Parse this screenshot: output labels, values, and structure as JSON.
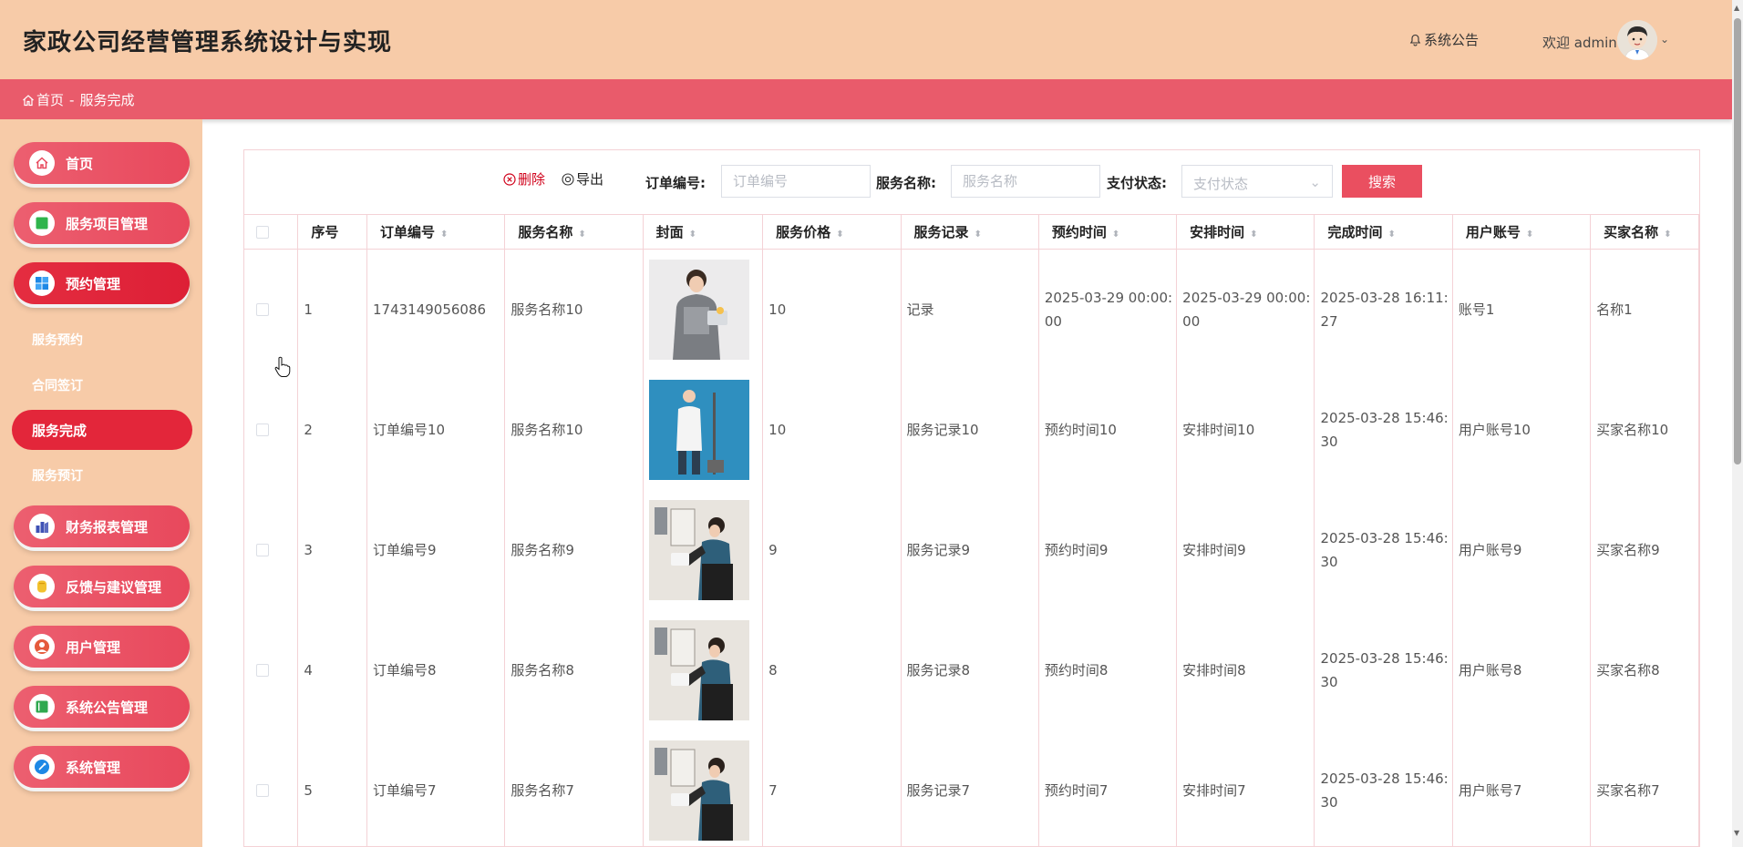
{
  "app": {
    "title": "家政公司经营管理系统设计与实现",
    "notice_label": "系统公告",
    "welcome": "欢迎 admin"
  },
  "breadcrumb": {
    "home": "首页",
    "separator": "-",
    "current": "服务完成"
  },
  "sidebar": {
    "items": [
      {
        "label": "首页",
        "icon": "home-icon"
      },
      {
        "label": "服务项目管理",
        "icon": "green-square-icon"
      },
      {
        "label": "预约管理",
        "icon": "windows-grid-icon"
      },
      {
        "label": "财务报表管理",
        "icon": "chart-icon"
      },
      {
        "label": "反馈与建议管理",
        "icon": "feedback-icon"
      },
      {
        "label": "用户管理",
        "icon": "user-icon"
      },
      {
        "label": "系统公告管理",
        "icon": "notice-board-icon"
      },
      {
        "label": "系统管理",
        "icon": "settings-icon"
      }
    ],
    "subitems": [
      "服务预约",
      "合同签订",
      "服务完成",
      "服务预订"
    ]
  },
  "toolbar": {
    "delete_label": "删除",
    "export_label": "导出",
    "order_no_label": "订单编号:",
    "order_no_placeholder": "订单编号",
    "service_name_label": "服务名称:",
    "service_name_placeholder": "服务名称",
    "pay_status_label": "支付状态:",
    "pay_status_placeholder": "支付状态",
    "search_label": "搜索"
  },
  "table": {
    "columns": [
      "序号",
      "订单编号",
      "服务名称",
      "封面",
      "服务价格",
      "服务记录",
      "预约时间",
      "安排时间",
      "完成时间",
      "用户账号",
      "买家名称"
    ],
    "rows": [
      {
        "index": "1",
        "order_no": "1743149056086",
        "service_name": "服务名称10",
        "price": "10",
        "record": "记录",
        "reserve_time": "2025-03-29 00:00:00",
        "arrange_time": "2025-03-29 00:00:00",
        "finish_time": "2025-03-28 16:11:27",
        "account": "账号1",
        "buyer": "名称1"
      },
      {
        "index": "2",
        "order_no": "订单编号10",
        "service_name": "服务名称10",
        "price": "10",
        "record": "服务记录10",
        "reserve_time": "预约时间10",
        "arrange_time": "安排时间10",
        "finish_time": "2025-03-28 15:46:30",
        "account": "用户账号10",
        "buyer": "买家名称10"
      },
      {
        "index": "3",
        "order_no": "订单编号9",
        "service_name": "服务名称9",
        "price": "9",
        "record": "服务记录9",
        "reserve_time": "预约时间9",
        "arrange_time": "安排时间9",
        "finish_time": "2025-03-28 15:46:30",
        "account": "用户账号9",
        "buyer": "买家名称9"
      },
      {
        "index": "4",
        "order_no": "订单编号8",
        "service_name": "服务名称8",
        "price": "8",
        "record": "服务记录8",
        "reserve_time": "预约时间8",
        "arrange_time": "安排时间8",
        "finish_time": "2025-03-28 15:46:30",
        "account": "用户账号8",
        "buyer": "买家名称8"
      },
      {
        "index": "5",
        "order_no": "订单编号7",
        "service_name": "服务名称7",
        "price": "7",
        "record": "服务记录7",
        "reserve_time": "预约时间7",
        "arrange_time": "安排时间7",
        "finish_time": "2025-03-28 15:46:30",
        "account": "用户账号7",
        "buyer": "买家名称7"
      }
    ]
  },
  "colors": {
    "header_bg": "#f7cba8",
    "crumb_bar": "#e95b6b",
    "menu_button": "#e8485c",
    "active_item": "#e3263a",
    "delete_text": "#d0021b",
    "search_button": "#ea4f60"
  }
}
